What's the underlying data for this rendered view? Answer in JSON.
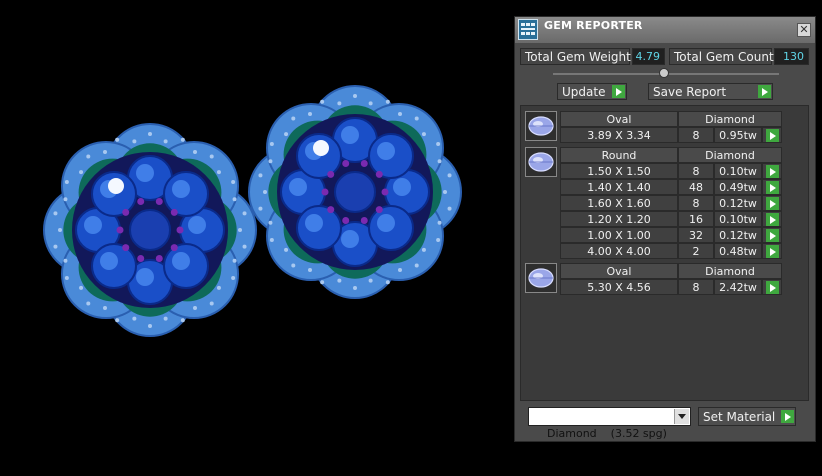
{
  "panel": {
    "title": "GEM REPORTER",
    "total_gem_weight_label": "Total Gem Weight",
    "total_gem_weight_value": "4.79",
    "total_gem_count_label": "Total Gem Count",
    "total_gem_count_value": "130",
    "update_label": "Update",
    "save_report_label": "Save Report",
    "material_select_value": "Diamond    (3.52 spg)",
    "set_material_label": "Set Material"
  },
  "groups": [
    {
      "shape": "Oval",
      "material": "Diamond",
      "rows": [
        {
          "size": "3.89 X 3.34",
          "count": "8",
          "weight": "0.95tw"
        }
      ]
    },
    {
      "shape": "Round",
      "material": "Diamond",
      "rows": [
        {
          "size": "1.50 X 1.50",
          "count": "8",
          "weight": "0.10tw"
        },
        {
          "size": "1.40 X 1.40",
          "count": "48",
          "weight": "0.49tw"
        },
        {
          "size": "1.60 X 1.60",
          "count": "8",
          "weight": "0.12tw"
        },
        {
          "size": "1.20 X 1.20",
          "count": "16",
          "weight": "0.10tw"
        },
        {
          "size": "1.00 X 1.00",
          "count": "32",
          "weight": "0.12tw"
        },
        {
          "size": "4.00 X 4.00",
          "count": "2",
          "weight": "0.48tw"
        }
      ]
    },
    {
      "shape": "Oval",
      "material": "Diamond",
      "rows": [
        {
          "size": "5.30 X 4.56",
          "count": "8",
          "weight": "2.42tw"
        }
      ]
    }
  ],
  "colors": {
    "value_text": "#5fd4e6",
    "play_green": "#3fa83f",
    "gem_blue": "#1a4fc8",
    "halo_blue": "#4a8ad8",
    "prong_purple": "#7a2ab0"
  },
  "icons": {
    "title": "gem-reporter-icon",
    "close": "close-icon",
    "group": "gem-shape-icon",
    "action": "play-arrow-icon"
  }
}
